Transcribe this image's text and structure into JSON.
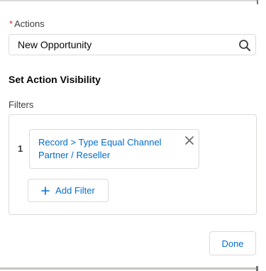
{
  "actions_field": {
    "required_marker": "*",
    "label": "Actions",
    "value": "New Opportunity",
    "search_icon": "search-icon"
  },
  "visibility": {
    "title": "Set Action Visibility",
    "filters_label": "Filters",
    "filters": [
      {
        "number": "1",
        "text": "Record > Type Equal Channel Partner / Reseller",
        "remove_icon": "close-icon"
      }
    ],
    "add_filter_label": "Add Filter",
    "add_filter_icon": "plus-icon"
  },
  "footer": {
    "done_label": "Done"
  },
  "colors": {
    "link_blue": "#0070d2",
    "pill_text_blue": "#006dcc",
    "border": "#dddbda",
    "required_red": "#c23934",
    "label_gray": "#3e3e3c"
  }
}
